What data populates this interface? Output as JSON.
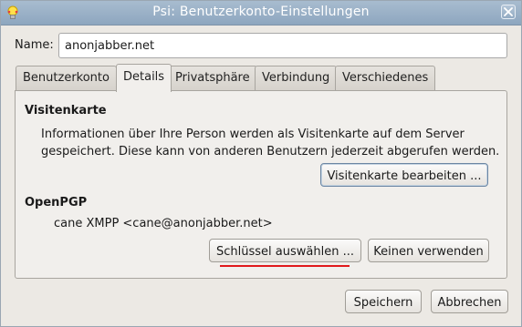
{
  "window": {
    "title": "Psi: Benutzerkonto-Einstellungen",
    "app_icon": "psi-bulb-icon",
    "close_icon": "close-icon"
  },
  "name_field": {
    "label": "Name:",
    "value": "anonjabber.net"
  },
  "tabs": [
    {
      "label": "Benutzerkonto",
      "active": false
    },
    {
      "label": "Details",
      "active": true
    },
    {
      "label": "Privatsphäre",
      "active": false
    },
    {
      "label": "Verbindung",
      "active": false
    },
    {
      "label": "Verschiedenes",
      "active": false
    }
  ],
  "details": {
    "vcard_heading": "Visitenkarte",
    "vcard_text": "Informationen über Ihre Person werden als Visitenkarte auf dem Server gespeichert. Diese kann von anderen Benutzern jederzeit abgerufen werden.",
    "vcard_button": "Visitenkarte bearbeiten ...",
    "pgp_heading": "OpenPGP",
    "pgp_key": "cane XMPP <cane@anonjabber.net>",
    "select_key_button": "Schlüssel auswählen ...",
    "no_key_button": "Keinen verwenden"
  },
  "footer": {
    "save_button": "Speichern",
    "cancel_button": "Abbrechen"
  },
  "colors": {
    "titlebar": "#98aec4",
    "annotation_underline": "#e0191b"
  }
}
